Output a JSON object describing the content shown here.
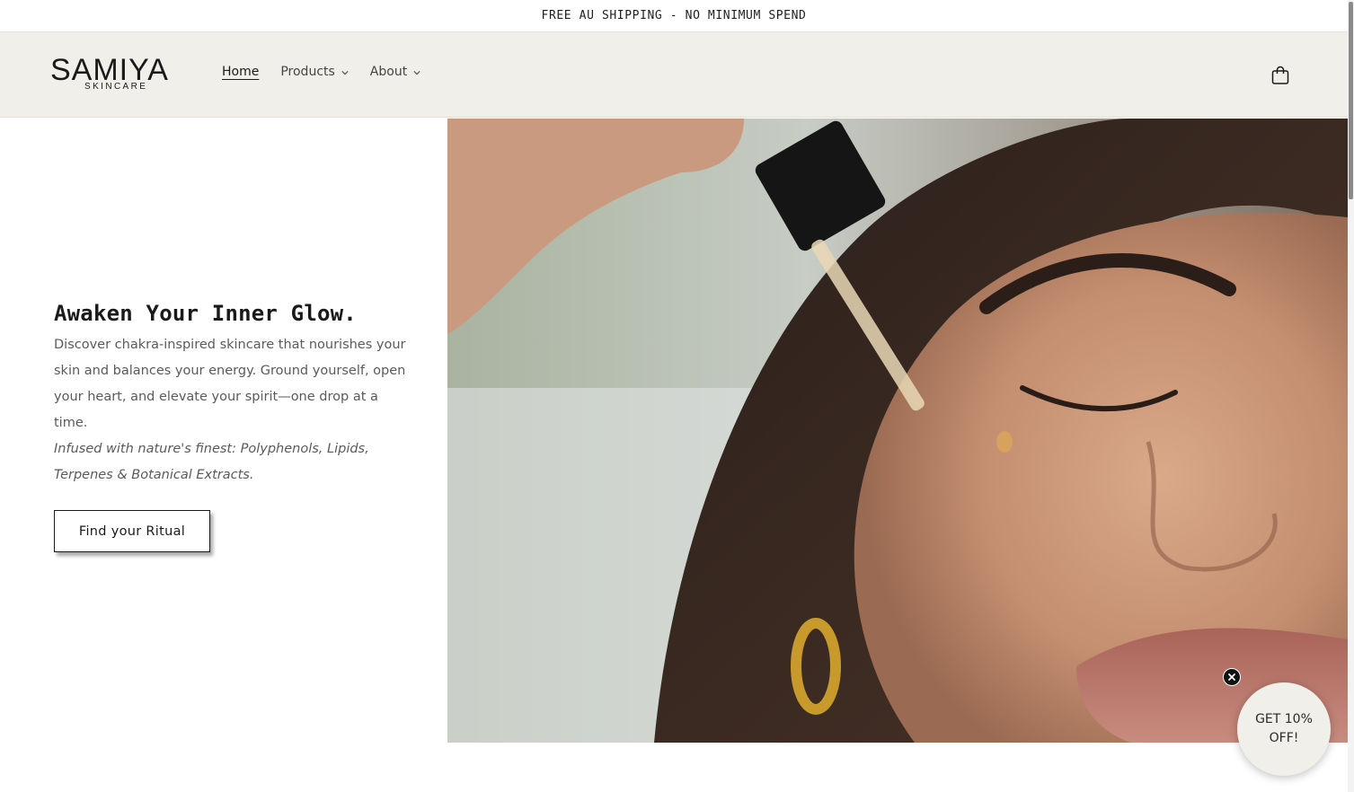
{
  "announcement": {
    "text": "FREE AU SHIPPING - NO MINIMUM SPEND"
  },
  "header": {
    "logo_main": "SAMIYA",
    "logo_sub": "SKINCARE",
    "nav": [
      {
        "label": "Home",
        "active": true
      },
      {
        "label": "Products",
        "has_dropdown": true
      },
      {
        "label": "About",
        "has_dropdown": true
      }
    ],
    "cart_icon": "shopping-bag-icon"
  },
  "hero": {
    "title": "Awaken Your Inner Glow.",
    "description": "Discover chakra-inspired skincare that nourishes your skin and balances your energy. Ground yourself, open your heart, and elevate your spirit—one drop at a time.",
    "ingredients": "Infused with nature's finest: Polyphenols, Lipids, Terpenes & Botanical Extracts.",
    "cta_label": "Find your Ritual"
  },
  "promo": {
    "label": "GET 10% OFF!",
    "close_icon": "close-icon"
  },
  "colors": {
    "header_bg": "#f1efe9",
    "text_dark": "#1a1a1a",
    "text_body": "#5a5a5a"
  }
}
